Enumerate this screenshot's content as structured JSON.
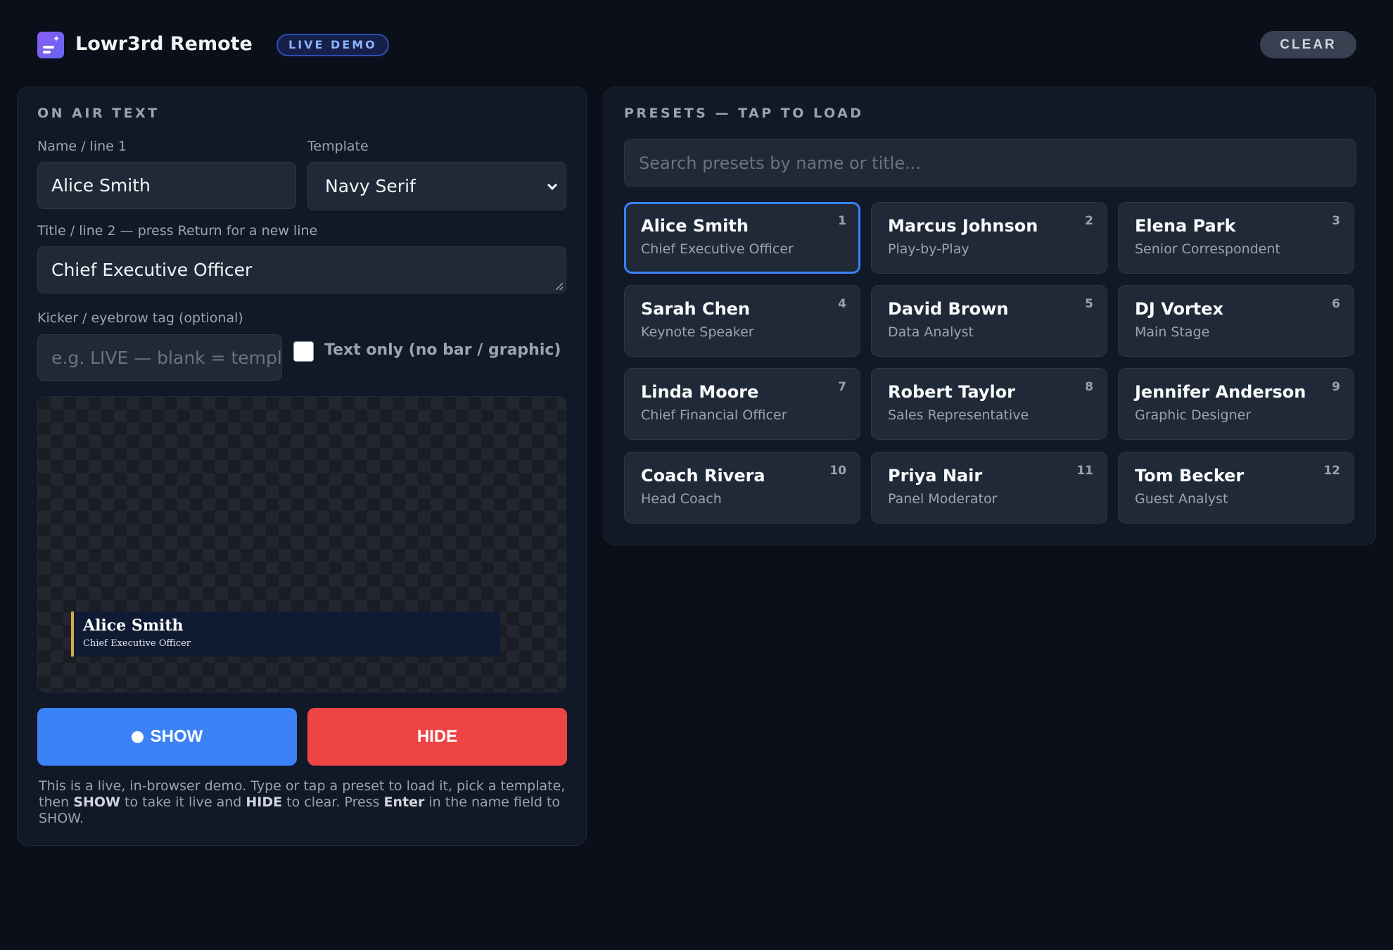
{
  "header": {
    "app_title": "Lowr3rd Remote",
    "badge": "LIVE DEMO",
    "clear_label": "CLEAR"
  },
  "on_air": {
    "section_title": "ON AIR TEXT",
    "name_label": "Name / line 1",
    "name_value": "Alice Smith",
    "template_label": "Template",
    "template_value": "Navy Serif",
    "title_label": "Title / line 2 — press Return for a new line",
    "title_value": "Chief Executive Officer",
    "kicker_label": "Kicker / eyebrow tag (optional)",
    "kicker_placeholder": "e.g. LIVE — blank = templ",
    "text_only_label": "Text only (no bar / graphic)",
    "preview": {
      "name": "Alice Smith",
      "title": "Chief Executive Officer",
      "bar_color": "#0f1b33",
      "accent_color": "#d4a943"
    },
    "show_label": "SHOW",
    "hide_label": "HIDE",
    "help": {
      "t1": "This is a live, in-browser demo. Type or tap a preset to load it, pick a template, then ",
      "b1": "SHOW",
      "t2": " to take it live and ",
      "b2": "HIDE",
      "t3": " to clear. Press ",
      "b3": "Enter",
      "t4": " in the name field to SHOW."
    }
  },
  "presets": {
    "section_title": "PRESETS — TAP TO LOAD",
    "search_placeholder": "Search presets by name or title...",
    "items": [
      {
        "num": "1",
        "name": "Alice Smith",
        "title": "Chief Executive Officer",
        "active": true
      },
      {
        "num": "2",
        "name": "Marcus Johnson",
        "title": "Play-by-Play"
      },
      {
        "num": "3",
        "name": "Elena Park",
        "title": "Senior Correspondent"
      },
      {
        "num": "4",
        "name": "Sarah Chen",
        "title": "Keynote Speaker"
      },
      {
        "num": "5",
        "name": "David Brown",
        "title": "Data Analyst"
      },
      {
        "num": "6",
        "name": "DJ Vortex",
        "title": "Main Stage"
      },
      {
        "num": "7",
        "name": "Linda Moore",
        "title": "Chief Financial Officer"
      },
      {
        "num": "8",
        "name": "Robert Taylor",
        "title": "Sales Representative"
      },
      {
        "num": "9",
        "name": "Jennifer Anderson",
        "title": "Graphic Designer"
      },
      {
        "num": "10",
        "name": "Coach Rivera",
        "title": "Head Coach"
      },
      {
        "num": "11",
        "name": "Priya Nair",
        "title": "Panel Moderator"
      },
      {
        "num": "12",
        "name": "Tom Becker",
        "title": "Guest Analyst"
      }
    ]
  },
  "colors": {
    "accent": "#3b82f6",
    "show": "#3b82f6",
    "hide": "#ef4444"
  }
}
